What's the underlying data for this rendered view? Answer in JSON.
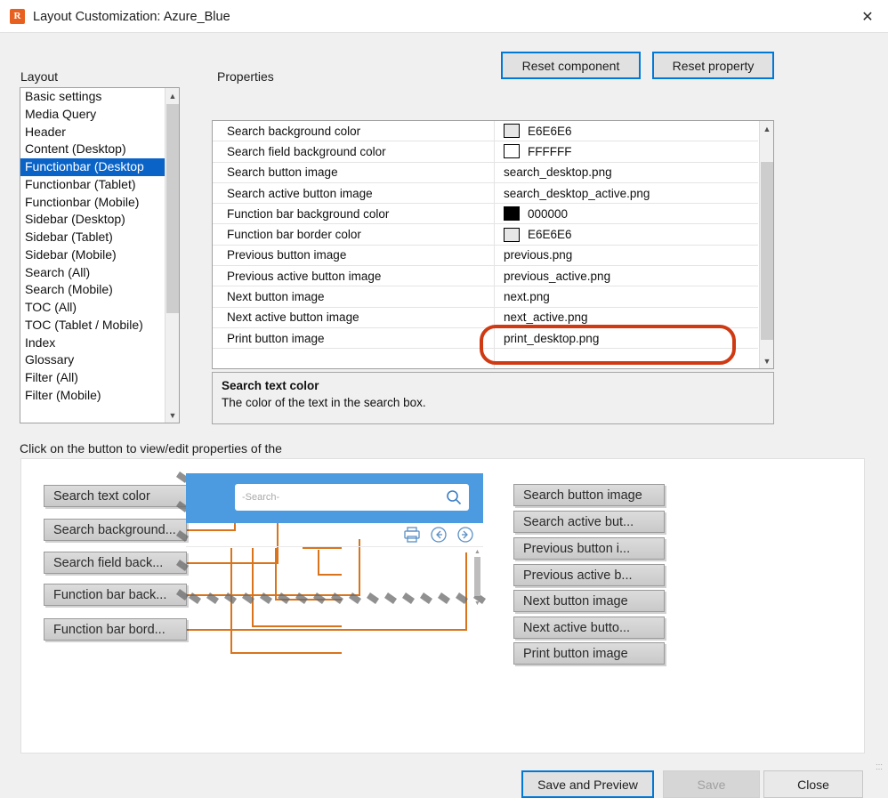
{
  "window": {
    "title": "Layout Customization: Azure_Blue",
    "app_icon": "app-logo-icon",
    "close_label": "✕"
  },
  "toolbar": {
    "reset_component_label": "Reset component",
    "reset_property_label": "Reset property"
  },
  "layout_panel": {
    "label": "Layout",
    "selected_index": 4,
    "items": [
      {
        "label": "Basic settings"
      },
      {
        "label": "Media Query"
      },
      {
        "label": "Header"
      },
      {
        "label": "Content (Desktop)"
      },
      {
        "label": "Functionbar (Desktop"
      },
      {
        "label": "Functionbar (Tablet)"
      },
      {
        "label": "Functionbar (Mobile)"
      },
      {
        "label": "Sidebar (Desktop)"
      },
      {
        "label": "Sidebar (Tablet)"
      },
      {
        "label": "Sidebar (Mobile)"
      },
      {
        "label": "Search (All)"
      },
      {
        "label": "Search (Mobile)"
      },
      {
        "label": "TOC (All)"
      },
      {
        "label": "TOC (Tablet / Mobile)"
      },
      {
        "label": "Index"
      },
      {
        "label": "Glossary"
      },
      {
        "label": "Filter (All)"
      },
      {
        "label": "Filter (Mobile)"
      }
    ]
  },
  "properties_panel": {
    "label": "Properties",
    "rows": [
      {
        "name": "Search background color",
        "value": "E6E6E6",
        "swatch": "#E6E6E6"
      },
      {
        "name": "Search field background color",
        "value": "FFFFFF",
        "swatch": "#FFFFFF"
      },
      {
        "name": "Search button image",
        "value": "search_desktop.png",
        "swatch": null
      },
      {
        "name": "Search active button image",
        "value": "search_desktop_active.png",
        "swatch": null
      },
      {
        "name": "Function bar background color",
        "value": "000000",
        "swatch": "#000000"
      },
      {
        "name": "Function bar border color",
        "value": "E6E6E6",
        "swatch": "#E6E6E6"
      },
      {
        "name": "Previous button image",
        "value": "previous.png",
        "swatch": null
      },
      {
        "name": "Previous active button image",
        "value": "previous_active.png",
        "swatch": null
      },
      {
        "name": "Next button image",
        "value": "next.png",
        "swatch": null
      },
      {
        "name": "Next active button image",
        "value": "next_active.png",
        "swatch": null
      },
      {
        "name": "Print button image",
        "value": "print_desktop.png",
        "swatch": null
      },
      {
        "name": "",
        "value": "",
        "swatch": null
      }
    ],
    "highlight_color": "#CF3A13"
  },
  "description": {
    "title": "Search text color",
    "text": "The color of the text in the search box."
  },
  "preview": {
    "hint": "Click on the button to view/edit properties of the",
    "search_placeholder": "-Search-",
    "left_callouts": [
      {
        "label": "Search text color"
      },
      {
        "label": "Search background..."
      },
      {
        "label": "Search field back..."
      },
      {
        "label": "Function bar back..."
      },
      {
        "label": "Function bar bord..."
      }
    ],
    "right_callouts": [
      {
        "label": "Search button image"
      },
      {
        "label": "Search active but..."
      },
      {
        "label": "Previous button i..."
      },
      {
        "label": "Previous active b..."
      },
      {
        "label": "Next button image"
      },
      {
        "label": "Next active butto..."
      },
      {
        "label": "Print button image"
      }
    ],
    "icons": [
      {
        "name": "print-icon"
      },
      {
        "name": "previous-arrow-icon"
      },
      {
        "name": "next-arrow-icon"
      }
    ]
  },
  "footer": {
    "save_preview_label": "Save and Preview",
    "save_label": "Save",
    "close_label": "Close"
  }
}
